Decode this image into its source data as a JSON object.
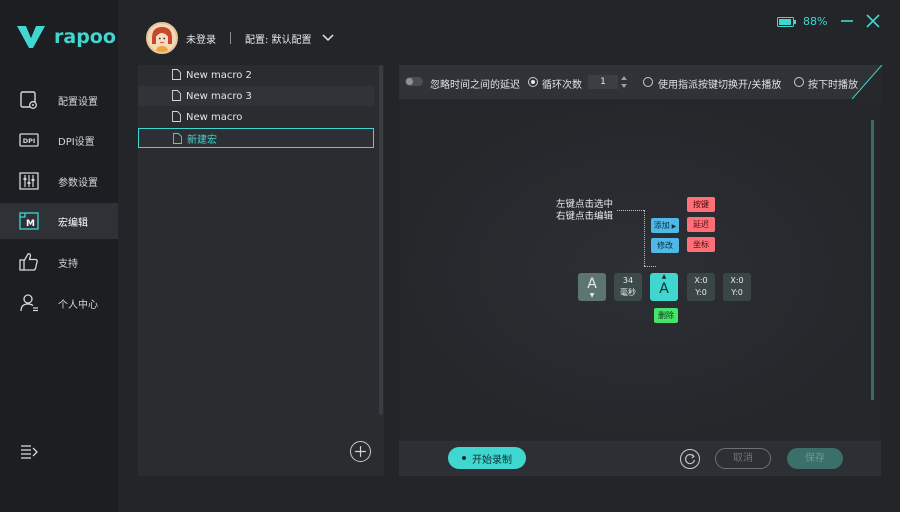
{
  "brand": {
    "name": "rapoo",
    "accent": "#3fd7d0"
  },
  "sidebar": {
    "items": [
      {
        "label": "配置设置",
        "icon": "profile-settings-icon"
      },
      {
        "label": "DPI设置",
        "icon": "dpi-icon"
      },
      {
        "label": "参数设置",
        "icon": "sliders-icon"
      },
      {
        "label": "宏编辑",
        "icon": "macro-icon",
        "active": true
      },
      {
        "label": "支持",
        "icon": "thumbs-up-icon"
      },
      {
        "label": "个人中心",
        "icon": "user-center-icon"
      }
    ],
    "menu_icon": "menu-collapse-icon"
  },
  "header": {
    "user_name": "未登录",
    "config_label": "配置: 默认配置",
    "battery": "88%"
  },
  "macro_list": {
    "items": [
      {
        "label": "New macro 2",
        "alt": false
      },
      {
        "label": "New macro 3",
        "alt": true
      },
      {
        "label": "New macro",
        "alt": false
      },
      {
        "label": "新建宏",
        "selected": true
      }
    ]
  },
  "toolbar": {
    "ignore_delay": "忽略时间之间的延迟",
    "loop_count_label": "循环次数",
    "loop_count_value": "1",
    "toggle_by_key": "使用指派按键切换开/关播放",
    "hold_to_play": "按下时播放"
  },
  "editor": {
    "hint_line1": "左键点击选中",
    "hint_line2": "右键点击编辑",
    "ctx_add": "添加",
    "ctx_modify": "修改",
    "ctx_key": "按键",
    "ctx_delay": "延迟",
    "ctx_coord": "坐标",
    "ctx_delete": "删除",
    "events": {
      "key1": "A",
      "delay_value": "34",
      "delay_unit": "毫秒",
      "key2": "A",
      "xy1_x": "X:0",
      "xy1_y": "Y:0",
      "xy2_x": "X:0",
      "xy2_y": "Y:0"
    }
  },
  "footer": {
    "record": "开始录制",
    "cancel": "取消",
    "save": "保存"
  }
}
